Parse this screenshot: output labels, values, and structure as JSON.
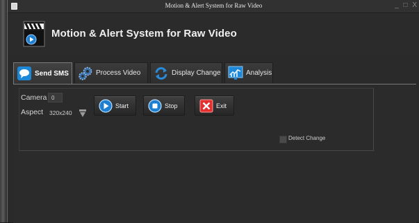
{
  "window": {
    "title": "Motion & Alert System for Raw Video",
    "controls": {
      "minimize": "_",
      "maximize": "□",
      "close": "X"
    }
  },
  "header": {
    "title": "Motion & Alert System for Raw Video",
    "logo_icon": "clapperboard-play-icon"
  },
  "tabs": [
    {
      "label": "Send SMS",
      "icon": "sms-chat-icon",
      "active": true
    },
    {
      "label": "Process Video",
      "icon": "gears-icon",
      "active": false
    },
    {
      "label": "Display Change",
      "icon": "refresh-arrows-icon",
      "active": false
    },
    {
      "label": "Analysis",
      "icon": "chart-monitor-icon",
      "active": false
    }
  ],
  "form": {
    "camera_label": "Camera",
    "camera_value": "0",
    "aspect_label": "Aspect",
    "aspect_value": "320x240",
    "detect_change_label": "Detect Change",
    "detect_change_checked": false
  },
  "buttons": {
    "start_label": "Start",
    "stop_label": "Stop",
    "exit_label": "Exit"
  },
  "colors": {
    "background": "#2b2b2b",
    "accent_blue": "#2a8ad8",
    "exit_red": "#e23030"
  }
}
